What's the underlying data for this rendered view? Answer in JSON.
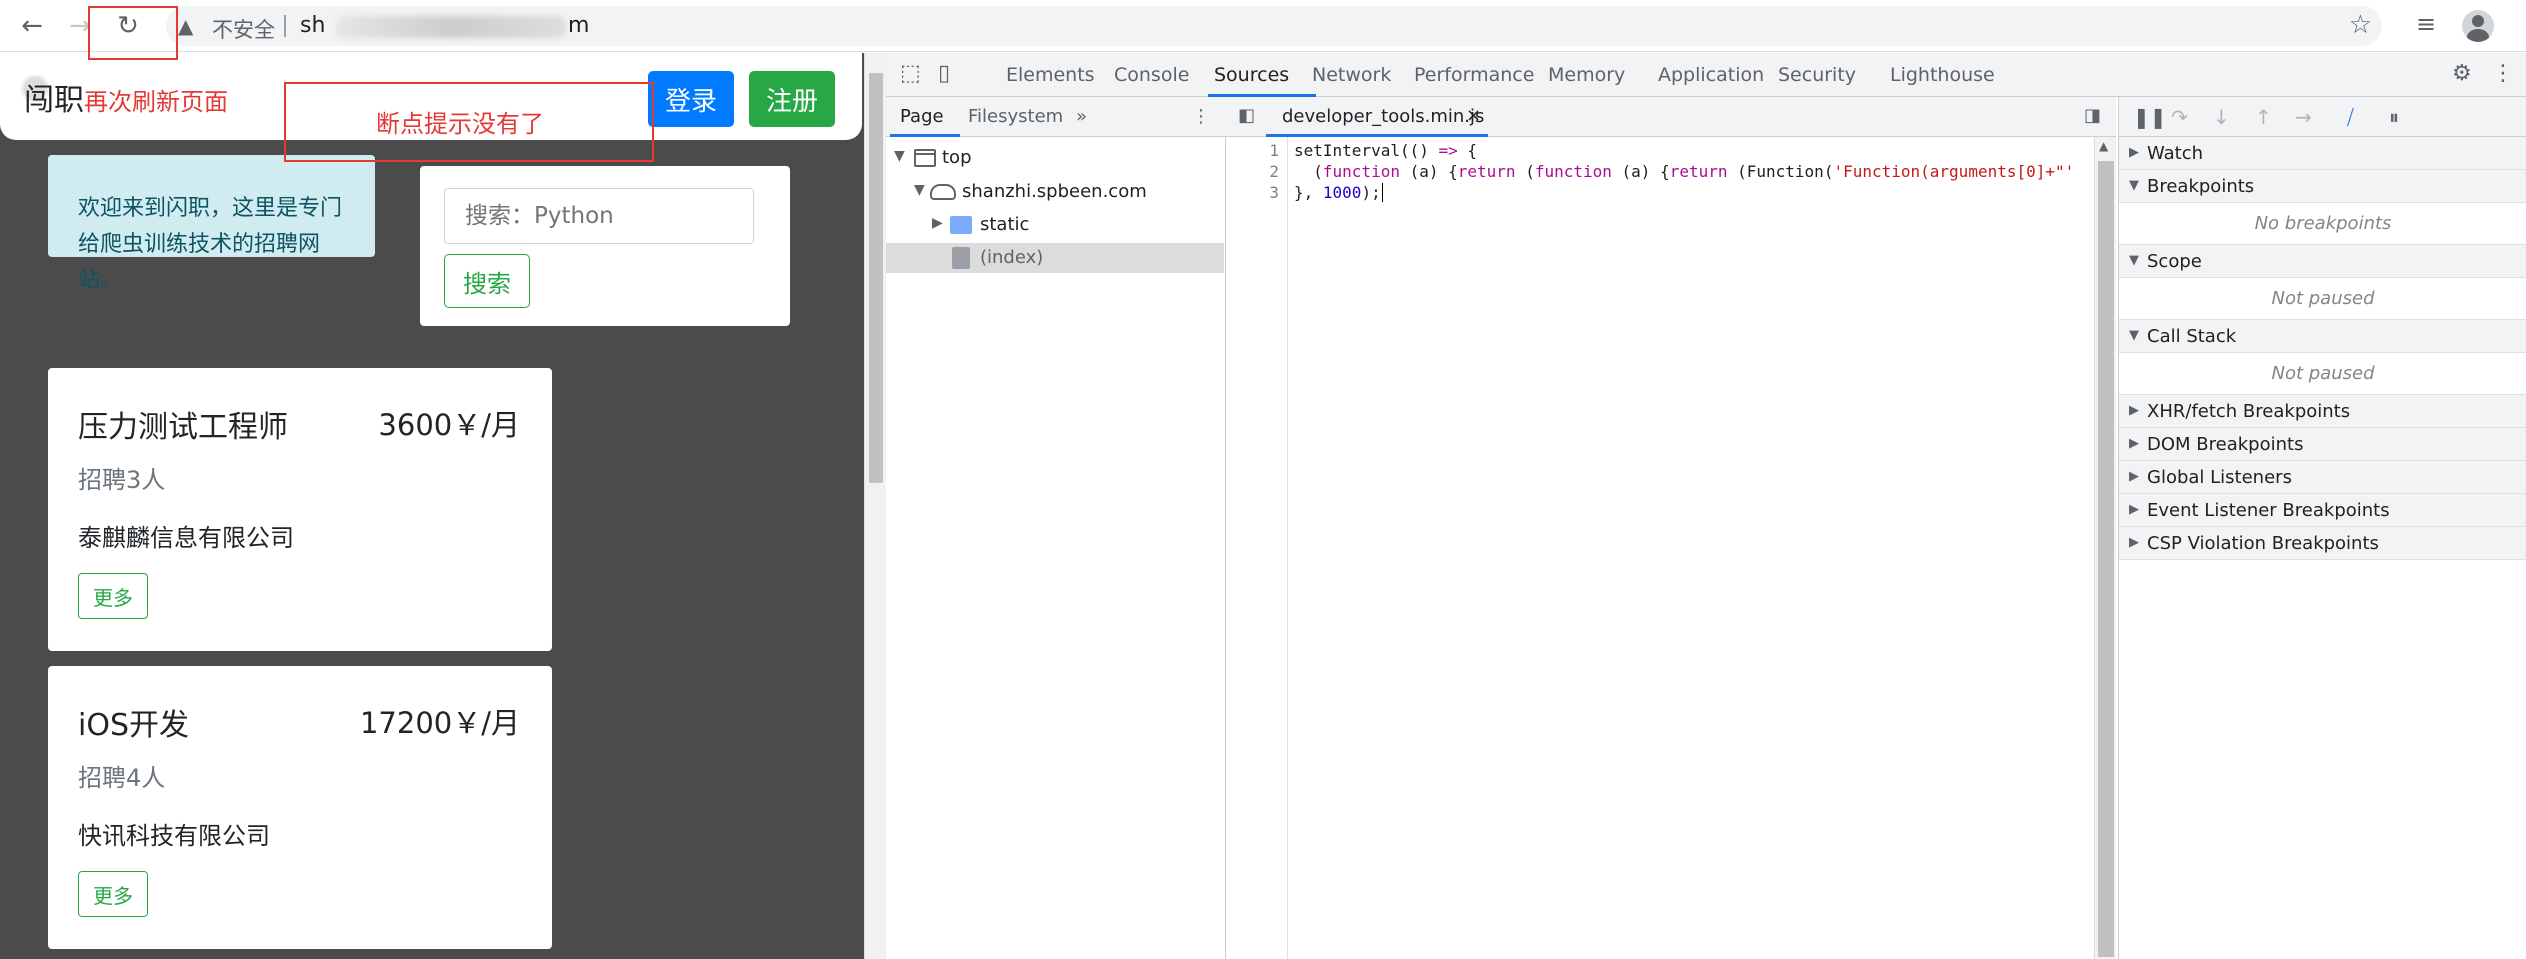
{
  "browser": {
    "insecure_label": "不安全",
    "url_head": "sh",
    "url_tail": "m"
  },
  "page": {
    "brand": "闯职",
    "login": "登录",
    "register": "注册",
    "welcome": "欢迎来到闪职，这里是专门给爬虫训练技术的招聘网站。",
    "search_placeholder": "搜索：Python",
    "search_button": "搜索",
    "jobs": [
      {
        "title": "压力测试工程师",
        "salary": "3600￥/月",
        "count": "招聘3人",
        "company": "泰麒麟信息有限公司",
        "more": "更多"
      },
      {
        "title": "iOS开发",
        "salary": "17200￥/月",
        "count": "招聘4人",
        "company": "快讯科技有限公司",
        "more": "更多"
      }
    ]
  },
  "annotations": {
    "refresh_again": "再次刷新页面",
    "breakpoint_gone": "断点提示没有了"
  },
  "devtools": {
    "tabs": [
      "Elements",
      "Console",
      "Sources",
      "Network",
      "Performance",
      "Memory",
      "Application",
      "Security",
      "Lighthouse"
    ],
    "active_tab": "Sources",
    "navigator": {
      "tabs": [
        "Page",
        "Filesystem"
      ],
      "tree": {
        "top": "top",
        "domain": "shanzhi.spbeen.com",
        "folder": "static",
        "file": "(index)"
      }
    },
    "editor": {
      "file": "developer_tools.min.js",
      "line_numbers": [
        "1",
        "2",
        "3"
      ],
      "code": {
        "l1_a": "setInterval",
        "l1_b": "(() ",
        "l1_c": "=>",
        "l1_d": " {",
        "l2_a": "  (",
        "l2_b": "function",
        "l2_c": " (a) {",
        "l2_d": "return",
        "l2_e": " (",
        "l2_f": "function",
        "l2_g": " (a) {",
        "l2_h": "return",
        "l2_i": " (Function(",
        "l2_j": "'Function(arguments[0]+\"'",
        "l3_a": "}, ",
        "l3_b": "1000",
        "l3_c": ");"
      }
    },
    "debugger": {
      "sections": {
        "watch": "Watch",
        "breakpoints": "Breakpoints",
        "no_breakpoints": "No breakpoints",
        "scope": "Scope",
        "scope_status": "Not paused",
        "callstack": "Call Stack",
        "callstack_status": "Not paused",
        "xhr": "XHR/fetch Breakpoints",
        "dom": "DOM Breakpoints",
        "global": "Global Listeners",
        "event": "Event Listener Breakpoints",
        "csp": "CSP Violation Breakpoints"
      }
    }
  }
}
